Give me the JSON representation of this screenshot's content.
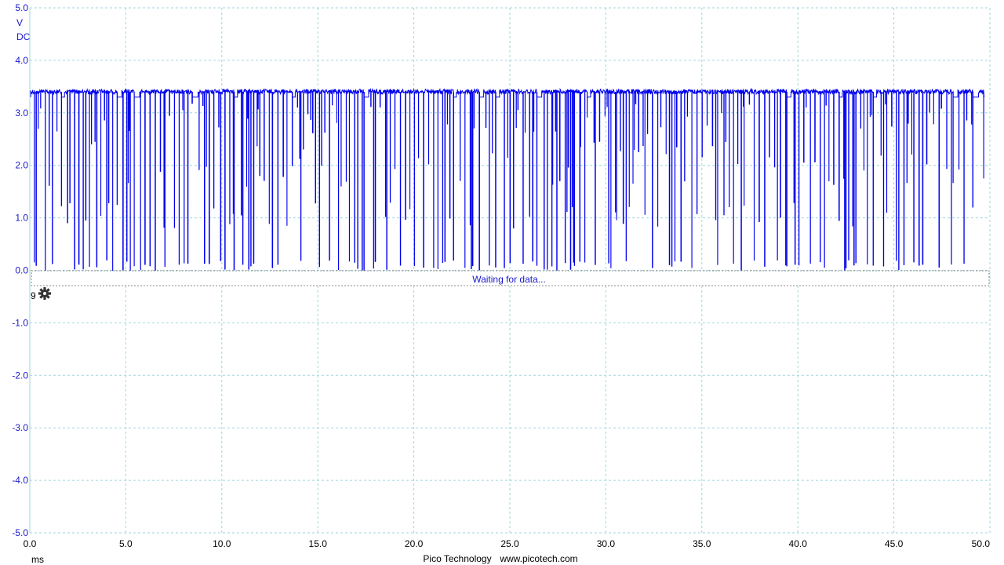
{
  "chart_data": {
    "type": "line",
    "title": "",
    "xlabel": "ms",
    "ylabel": "V",
    "coupling": "DC",
    "xlim": [
      0.0,
      50.0
    ],
    "ylim": [
      -5.0,
      5.0
    ],
    "grid": true,
    "x_ticks": [
      "0.0",
      "5.0",
      "10.0",
      "15.0",
      "20.0",
      "25.0",
      "30.0",
      "35.0",
      "40.0",
      "45.0",
      "50.0"
    ],
    "y_ticks": [
      "5.0",
      "4.0",
      "3.0",
      "2.0",
      "1.0",
      "0.0",
      "-1.0",
      "-2.0",
      "-3.0",
      "-4.0",
      "-5.0"
    ],
    "signal": {
      "description_values": "digital serial data burst",
      "high_level": 3.45,
      "low_level": 0.0,
      "idle_level": 3.3,
      "color": "#0000ee"
    }
  },
  "channel": {
    "label": "9",
    "settings_icon": "gear-icon"
  },
  "status": {
    "message": "Waiting for data..."
  },
  "footer": {
    "brand": "Pico Technology",
    "url": "www.picotech.com"
  },
  "colors": {
    "grid": "#9fd6dc",
    "axis_text": "#1a1acc",
    "trace": "#0000ee"
  }
}
